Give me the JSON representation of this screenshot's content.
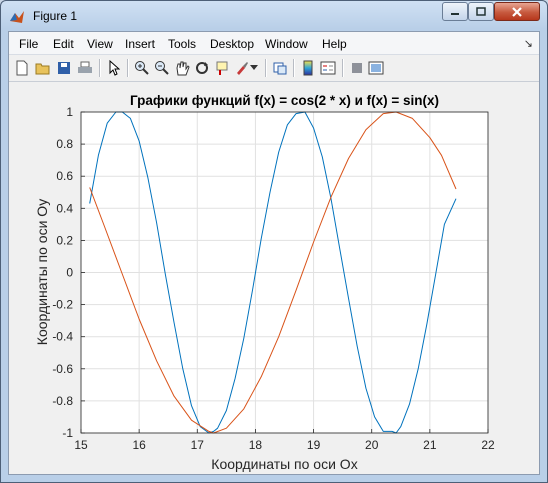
{
  "window": {
    "title": "Figure 1"
  },
  "menu": [
    "File",
    "Edit",
    "View",
    "Insert",
    "Tools",
    "Desktop",
    "Window",
    "Help"
  ],
  "toolbar_icons": [
    "new-figure-icon",
    "open-file-icon",
    "save-icon",
    "print-icon",
    "edit-plot-arrow-icon",
    "zoom-in-icon",
    "zoom-out-icon",
    "pan-hand-icon",
    "rotate-3d-icon",
    "data-cursor-icon",
    "brush-icon",
    "link-plot-icon",
    "colorbar-icon",
    "legend-icon",
    "hide-plot-tools-icon",
    "show-plot-tools-icon"
  ],
  "colors": {
    "series_cos": "#0072bd",
    "series_sin": "#d95319",
    "grid": "#e1e1e1",
    "axes": "#262626"
  },
  "chart_data": {
    "type": "line",
    "title": "Графики функций f(x) = cos(2 * x) и f(x) = sin(x)",
    "xlabel": "Координаты по оси Ox",
    "ylabel": "Координаты по оси Oy",
    "xlim": [
      15,
      22
    ],
    "ylim": [
      -1,
      1
    ],
    "xticks": [
      "15",
      "16",
      "17",
      "18",
      "19",
      "20",
      "21",
      "22"
    ],
    "yticks": [
      "-1",
      "-0.8",
      "-0.6",
      "-0.4",
      "-0.2",
      "0",
      "0.2",
      "0.4",
      "0.6",
      "0.8",
      "1"
    ],
    "grid": true,
    "x_range": [
      15.15,
      21.45
    ],
    "series": [
      {
        "function": "cos(2 * x)",
        "color": "#0072bd",
        "x": [
          15.15,
          15.3,
          15.45,
          15.6,
          15.71,
          15.85,
          16.0,
          16.15,
          16.3,
          16.45,
          16.6,
          16.75,
          16.9,
          17.05,
          17.2,
          17.28,
          17.35,
          17.5,
          17.65,
          17.8,
          17.95,
          18.1,
          18.25,
          18.4,
          18.55,
          18.7,
          18.85,
          19.0,
          19.15,
          19.3,
          19.45,
          19.6,
          19.75,
          19.9,
          20.05,
          20.2,
          20.35,
          20.42,
          20.5,
          20.65,
          20.8,
          20.95,
          21.1,
          21.25,
          21.45
        ],
        "y": [
          0.43,
          0.73,
          0.93,
          1.0,
          1.0,
          0.96,
          0.82,
          0.59,
          0.31,
          -0.01,
          -0.31,
          -0.6,
          -0.83,
          -0.96,
          -1.0,
          -0.99,
          -0.97,
          -0.86,
          -0.66,
          -0.41,
          -0.11,
          0.21,
          0.5,
          0.75,
          0.92,
          0.99,
          1.0,
          0.9,
          0.72,
          0.46,
          0.15,
          -0.16,
          -0.46,
          -0.72,
          -0.9,
          -0.99,
          -0.99,
          -1.0,
          -0.96,
          -0.82,
          -0.6,
          -0.32,
          -0.01,
          0.3,
          0.46
        ]
      },
      {
        "function": "sin(x)",
        "color": "#d95319",
        "x": [
          15.15,
          15.4,
          15.7,
          16.0,
          16.3,
          16.6,
          16.9,
          17.2,
          17.28,
          17.5,
          17.8,
          18.1,
          18.4,
          18.7,
          19.0,
          19.3,
          19.6,
          19.9,
          20.2,
          20.42,
          20.7,
          21.0,
          21.2,
          21.45
        ],
        "y": [
          0.53,
          0.29,
          0.0,
          -0.29,
          -0.55,
          -0.77,
          -0.92,
          -0.99,
          -1.0,
          -0.97,
          -0.85,
          -0.65,
          -0.4,
          -0.11,
          0.19,
          0.47,
          0.71,
          0.89,
          0.99,
          1.0,
          0.96,
          0.84,
          0.73,
          0.52
        ]
      }
    ]
  }
}
